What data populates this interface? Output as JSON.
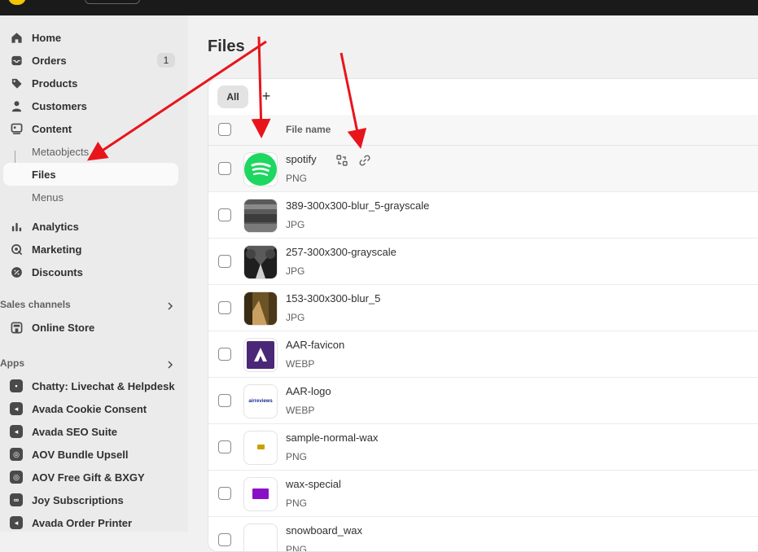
{
  "sidebar": {
    "items": [
      {
        "label": "Home",
        "icon": "home-icon"
      },
      {
        "label": "Orders",
        "icon": "inbox-icon",
        "badge": "1"
      },
      {
        "label": "Products",
        "icon": "tag-icon"
      },
      {
        "label": "Customers",
        "icon": "person-icon"
      },
      {
        "label": "Content",
        "icon": "content-icon"
      },
      {
        "label": "Metaobjects"
      },
      {
        "label": "Files"
      },
      {
        "label": "Menus"
      },
      {
        "label": "Analytics",
        "icon": "bar-chart-icon"
      },
      {
        "label": "Marketing",
        "icon": "target-icon"
      },
      {
        "label": "Discounts",
        "icon": "discount-icon"
      }
    ],
    "sales_channels": {
      "heading": "Sales channels",
      "items": [
        {
          "label": "Online Store",
          "icon": "store-icon"
        }
      ]
    },
    "apps": {
      "heading": "Apps",
      "items": [
        {
          "label": "Chatty: Livechat & Helpdesk"
        },
        {
          "label": "Avada Cookie Consent"
        },
        {
          "label": "Avada SEO Suite"
        },
        {
          "label": "AOV Bundle Upsell"
        },
        {
          "label": "AOV Free Gift & BXGY"
        },
        {
          "label": "Joy Subscriptions"
        },
        {
          "label": "Avada Order Printer"
        }
      ]
    }
  },
  "main": {
    "title": "Files",
    "tabs": {
      "all": "All",
      "add": "+"
    },
    "table": {
      "header_name": "File name",
      "rows": [
        {
          "name": "spotify",
          "type": "PNG",
          "thumb": "spotify"
        },
        {
          "name": "389-300x300-blur_5-grayscale",
          "type": "JPG",
          "thumb": "gray-blur"
        },
        {
          "name": "257-300x300-grayscale",
          "type": "JPG",
          "thumb": "gray-tunnel"
        },
        {
          "name": "153-300x300-blur_5",
          "type": "JPG",
          "thumb": "warm-blur"
        },
        {
          "name": "AAR-favicon",
          "type": "WEBP",
          "thumb": "aar-favicon"
        },
        {
          "name": "AAR-logo",
          "type": "WEBP",
          "thumb": "aar-logo"
        },
        {
          "name": "sample-normal-wax",
          "type": "PNG",
          "thumb": "wax-small"
        },
        {
          "name": "wax-special",
          "type": "PNG",
          "thumb": "wax-purple"
        },
        {
          "name": "snowboard_wax",
          "type": "PNG",
          "thumb": "wax"
        }
      ]
    },
    "aar_logo_text": "airreviews"
  }
}
